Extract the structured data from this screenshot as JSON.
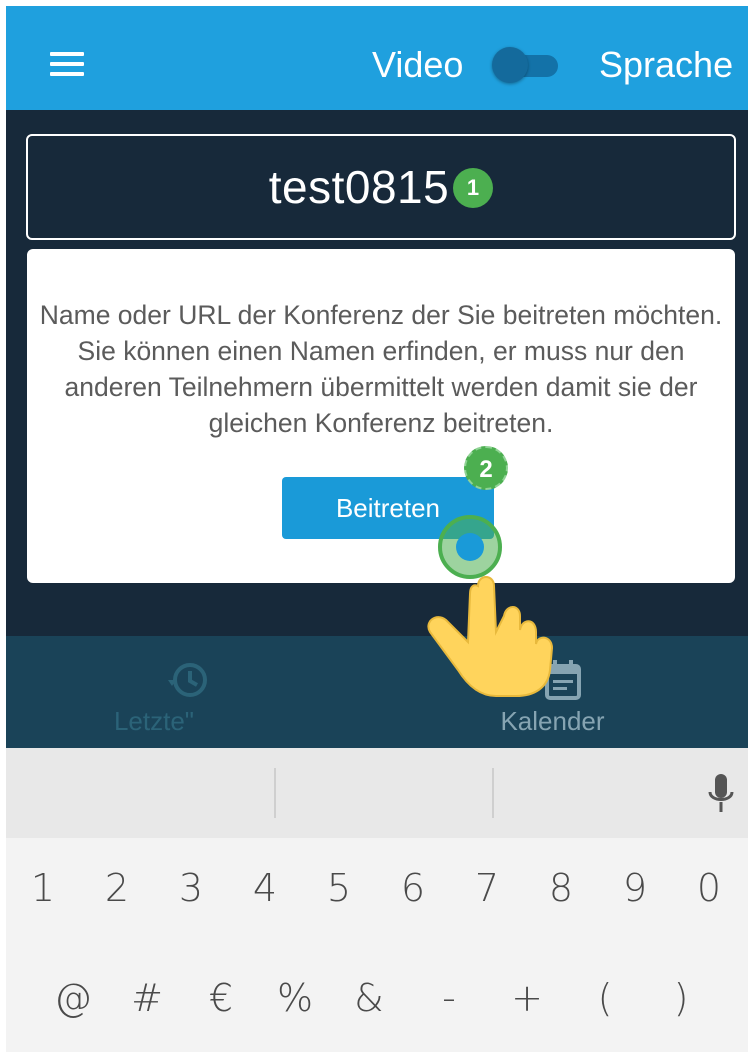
{
  "app_bar": {
    "menu_icon": "hamburger-menu-icon",
    "video_label": "Video",
    "sprache_label": "Sprache",
    "toggle_state": "off",
    "color": "#1fa0de"
  },
  "room": {
    "value": "test0815",
    "badge": "1"
  },
  "card": {
    "description": "Name oder URL der Konferenz der Sie beitreten möchten. Sie können einen Namen erfinden, er muss nur den anderen Teilnehmern übermittelt werden damit sie der gleichen Konferenz beitreten.",
    "join_label": "Beitreten",
    "step_badge": "2"
  },
  "tabs": [
    {
      "label": "Letzte\"",
      "icon": "history-icon"
    },
    {
      "label": "Kalender",
      "icon": "calendar-icon"
    }
  ],
  "keyboard": {
    "row1": [
      "1",
      "2",
      "3",
      "4",
      "5",
      "6",
      "7",
      "8",
      "9",
      "0"
    ],
    "row2": [
      "@",
      "#",
      "€",
      "%",
      "&",
      "-",
      "+",
      "(",
      ")"
    ],
    "mic_icon": "microphone-icon"
  }
}
